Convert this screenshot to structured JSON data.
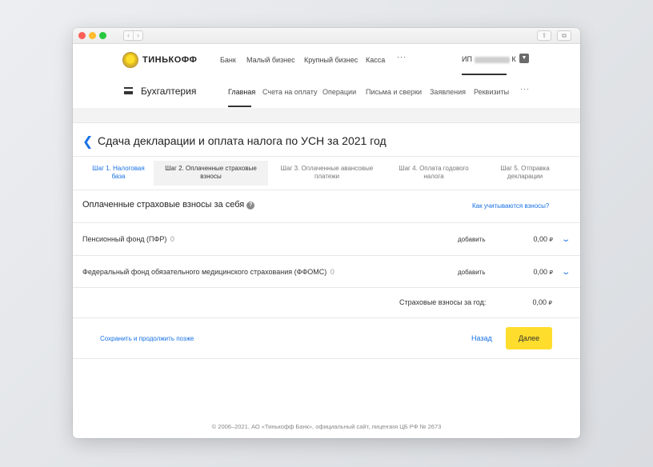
{
  "browser": {
    "nav_back": "‹",
    "nav_forward": "›",
    "share_icon": "⇪",
    "tabs_icon": "⧉"
  },
  "top_nav": {
    "brand": "ТИНЬКОФФ",
    "items": [
      "Банк",
      "Малый бизнес",
      "Крупный бизнес",
      "Касса"
    ],
    "more": "···",
    "user_prefix": "ИП",
    "user_suffix": "К"
  },
  "sub_nav": {
    "section_title": "Бухгалтерия",
    "items": [
      "Главная",
      "Счета на оплату",
      "Операции",
      "Письма и сверки",
      "Заявления",
      "Реквизиты"
    ],
    "more": "···"
  },
  "page": {
    "title": "Сдача декларации и оплата налога по УСН за 2021 год",
    "steps": [
      "Шаг 1. Налоговая база",
      "Шаг 2. Оплаченные страховые взносы",
      "Шаг 3. Оплаченные авансовые платежи",
      "Шаг 4. Оплата годового налога",
      "Шаг 5. Отправка декларации"
    ],
    "active_step": 2,
    "section_heading": "Оплаченные страховые взносы за себя",
    "help_link": "Как учитываются взносы?",
    "rows": [
      {
        "label": "Пенсионный фонд (ПФР)",
        "count": "0",
        "action": "добавить",
        "amount": "0,00",
        "currency": "₽"
      },
      {
        "label": "Федеральный фонд обязательного медицинского страхования (ФФОМС)",
        "count": "0",
        "action": "добавить",
        "amount": "0,00",
        "currency": "₽"
      }
    ],
    "total_label": "Страховые взносы за год:",
    "total_amount": "0,00",
    "total_currency": "₽",
    "save_later": "Сохранить и продолжить позже",
    "back": "Назад",
    "next": "Далее"
  },
  "footer": "© 2006–2021, АО «Тинькофф Банк», официальный сайт, лицензия ЦБ РФ № 2673",
  "colors": {
    "accent_blue": "#1771e6",
    "brand_yellow": "#ffdd2d"
  }
}
